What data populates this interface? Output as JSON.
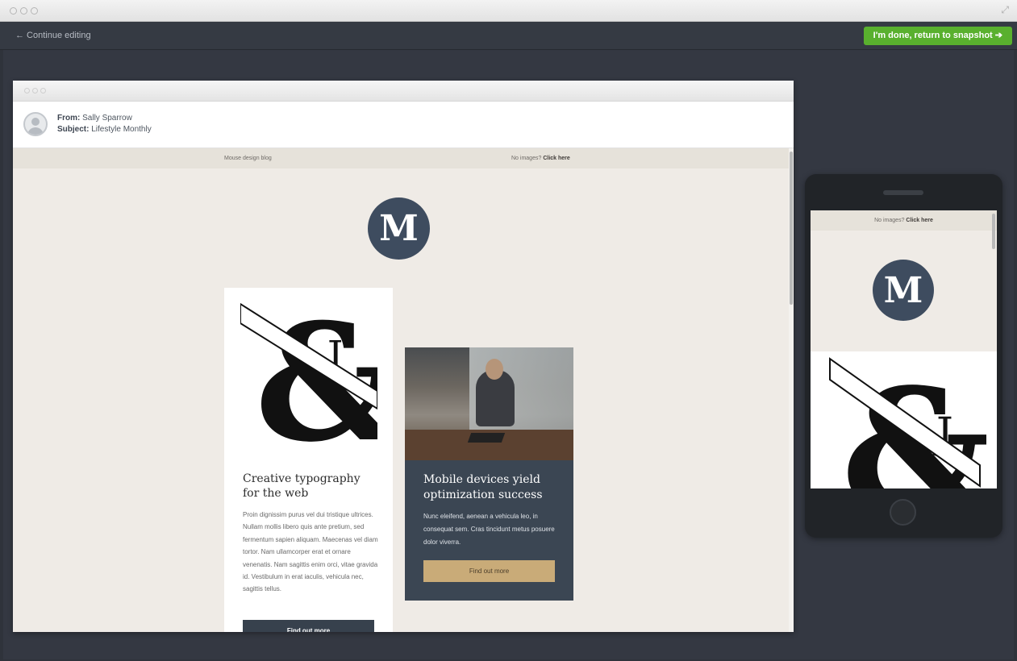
{
  "toolbar": {
    "back_label": "← Continue editing",
    "done_label": "I'm done, return to snapshot ➔"
  },
  "email": {
    "from_label": "From:",
    "from_value": "Sally Sparrow",
    "subject_label": "Subject:",
    "subject_value": "Lifestyle Monthly",
    "preheader_left": "Mouse design blog",
    "preheader_right_prefix": "No images?",
    "preheader_right_link": "Click here",
    "logo_letter": "M",
    "card1": {
      "title": "Creative typography for the web",
      "body": "Proin dignissim purus vel dui tristique ultrices. Nullam mollis libero quis ante pretium, sed fermentum sapien aliquam. Maecenas vel diam tortor. Nam ullamcorper erat et ornare venenatis. Nam sagittis enim orci, vitae gravida id. Vestibulum in erat iaculis, vehicula nec, sagittis tellus.",
      "button": "Find out more"
    },
    "card2": {
      "title": "Mobile devices yield optimization success",
      "body": "Nunc eleifend, aenean a vehicula leo, in consequat sem. Cras tincidunt metus posuere dolor viverra.",
      "button": "Find out more"
    }
  },
  "colors": {
    "accent_green": "#59b02e",
    "navy": "#3e4c5f",
    "gold": "#c9ab78",
    "background": "#efebe6"
  }
}
